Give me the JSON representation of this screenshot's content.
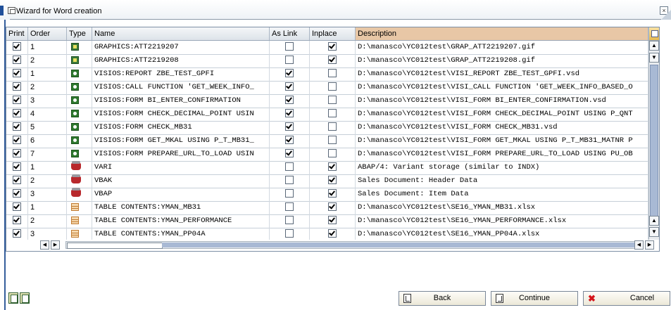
{
  "window": {
    "title": "Wizard for Word creation",
    "close_label": "×"
  },
  "columns": [
    "Print",
    "Order",
    "Type",
    "Name",
    "As Link",
    "Inplace",
    "Description"
  ],
  "rows": [
    {
      "print": true,
      "order": "1",
      "type": "graphic-icon",
      "name": "GRAPHICS:ATT2219207",
      "as_link": false,
      "inplace": true,
      "description": "D:\\manasco\\YC012test\\GRAP_ATT2219207.gif"
    },
    {
      "print": true,
      "order": "2",
      "type": "graphic-icon",
      "name": "GRAPHICS:ATT2219208",
      "as_link": false,
      "inplace": true,
      "description": "D:\\manasco\\YC012test\\GRAP_ATT2219208.gif"
    },
    {
      "print": true,
      "order": "1",
      "type": "visio-icon",
      "name": "VISIOS:REPORT ZBE_TEST_GPFI",
      "as_link": true,
      "inplace": false,
      "description": "D:\\manasco\\YC012test\\VISI_REPORT ZBE_TEST_GPFI.vsd"
    },
    {
      "print": true,
      "order": "2",
      "type": "visio-icon",
      "name": "VISIOS:CALL FUNCTION 'GET_WEEK_INFO_",
      "as_link": true,
      "inplace": false,
      "description": "D:\\manasco\\YC012test\\VISI_CALL FUNCTION 'GET_WEEK_INFO_BASED_O"
    },
    {
      "print": true,
      "order": "3",
      "type": "visio-icon",
      "name": "VISIOS:FORM BI_ENTER_CONFIRMATION",
      "as_link": true,
      "inplace": false,
      "description": "D:\\manasco\\YC012test\\VISI_FORM BI_ENTER_CONFIRMATION.vsd"
    },
    {
      "print": true,
      "order": "4",
      "type": "visio-icon",
      "name": "VISIOS:FORM CHECK_DECIMAL_POINT USIN",
      "as_link": true,
      "inplace": false,
      "description": "D:\\manasco\\YC012test\\VISI_FORM CHECK_DECIMAL_POINT USING P_QNT"
    },
    {
      "print": true,
      "order": "5",
      "type": "visio-icon",
      "name": "VISIOS:FORM CHECK_MB31",
      "as_link": true,
      "inplace": false,
      "description": "D:\\manasco\\YC012test\\VISI_FORM CHECK_MB31.vsd"
    },
    {
      "print": true,
      "order": "6",
      "type": "visio-icon",
      "name": "VISIOS:FORM GET_MKAL USING P_T_MB31_",
      "as_link": true,
      "inplace": false,
      "description": "D:\\manasco\\YC012test\\VISI_FORM GET_MKAL USING P_T_MB31_MATNR P"
    },
    {
      "print": true,
      "order": "7",
      "type": "visio-icon",
      "name": "VISIOS:FORM PREPARE_URL_TO_LOAD USIN",
      "as_link": true,
      "inplace": false,
      "description": "D:\\manasco\\YC012test\\VISI_FORM PREPARE_URL_TO_LOAD USING PU_OB"
    },
    {
      "print": true,
      "order": "1",
      "type": "vari-icon",
      "name": "VARI",
      "as_link": false,
      "inplace": true,
      "description": "ABAP/4: Variant storage (similar to INDX)"
    },
    {
      "print": true,
      "order": "2",
      "type": "vari-icon",
      "name": "VBAK",
      "as_link": false,
      "inplace": true,
      "description": "Sales Document: Header Data"
    },
    {
      "print": true,
      "order": "3",
      "type": "vari-icon",
      "name": "VBAP",
      "as_link": false,
      "inplace": true,
      "description": "Sales Document: Item Data"
    },
    {
      "print": true,
      "order": "1",
      "type": "table-icon",
      "name": "TABLE CONTENTS:YMAN_MB31",
      "as_link": false,
      "inplace": true,
      "description": "D:\\manasco\\YC012test\\SE16_YMAN_MB31.xlsx"
    },
    {
      "print": true,
      "order": "2",
      "type": "table-icon",
      "name": "TABLE CONTENTS:YMAN_PERFORMANCE",
      "as_link": false,
      "inplace": true,
      "description": "D:\\manasco\\YC012test\\SE16_YMAN_PERFORMANCE.xlsx"
    },
    {
      "print": true,
      "order": "3",
      "type": "table-icon",
      "name": "TABLE CONTENTS:YMAN_PP04A",
      "as_link": false,
      "inplace": true,
      "description": "D:\\manasco\\YC012test\\SE16_YMAN_PP04A.xlsx"
    }
  ],
  "buttons": {
    "back": "Back",
    "continue": "Continue",
    "cancel": "Cancel"
  }
}
